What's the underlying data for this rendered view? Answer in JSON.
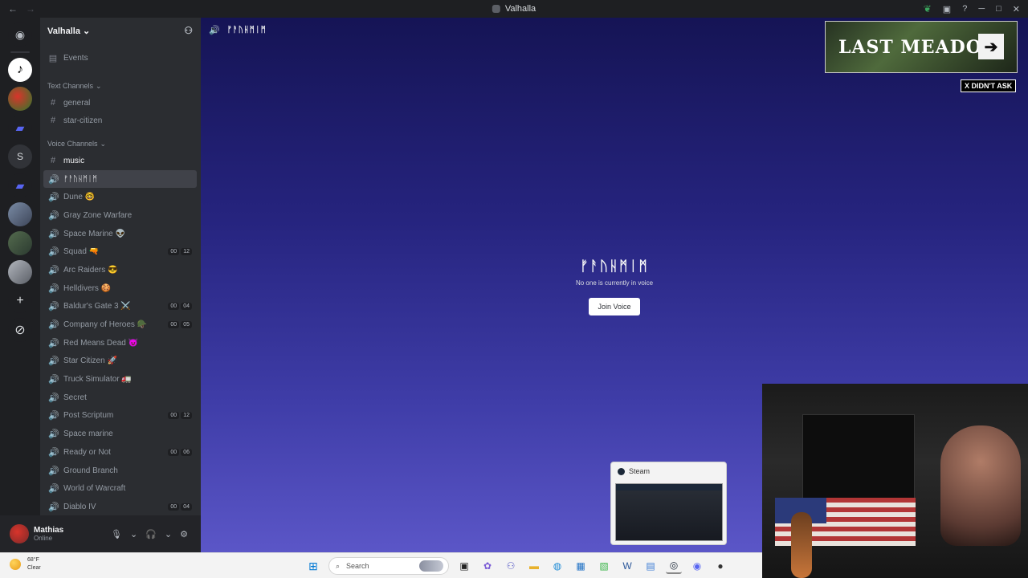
{
  "window": {
    "title": "Valhalla",
    "nav_back": "←",
    "nav_fwd": "→"
  },
  "titlebar_icons": {
    "leaf": "leaf-icon",
    "inbox": "inbox-icon",
    "help": "?",
    "minimize": "─",
    "maximize": "□",
    "close": "✕"
  },
  "rail": {
    "home_icon": "discord-icon",
    "s_label": "S",
    "add_icon": "+",
    "explore_icon": "compass-icon"
  },
  "guild": {
    "name": "Valhalla",
    "chevron": "⌄"
  },
  "sidebar": {
    "events_label": "Events",
    "text_category": "Text Channels",
    "voice_category": "Voice Channels",
    "text_channels": [
      {
        "name": "general"
      },
      {
        "name": "star-citizen"
      }
    ],
    "voice_channels": [
      {
        "name": "music",
        "type": "text"
      },
      {
        "name": "ᚠᚨᚢᚺᛗᛁᛗ",
        "type": "voice"
      },
      {
        "name": "Dune 🤓",
        "type": "voice"
      },
      {
        "name": "Gray Zone Warfare",
        "type": "voice"
      },
      {
        "name": "Space Marine 👽",
        "type": "voice"
      },
      {
        "name": "Squad 🔫",
        "type": "voice",
        "counts": [
          "00",
          "12"
        ]
      },
      {
        "name": "Arc Raiders 😎",
        "type": "voice"
      },
      {
        "name": "Helldivers 🍪",
        "type": "voice"
      },
      {
        "name": "Baldur's Gate 3 ⚔️",
        "type": "voice",
        "counts": [
          "00",
          "04"
        ]
      },
      {
        "name": "Company of Heroes 🪖",
        "type": "voice",
        "counts": [
          "00",
          "05"
        ]
      },
      {
        "name": "Red Means Dead 😈",
        "type": "voice"
      },
      {
        "name": "Star Citizen 🚀",
        "type": "voice"
      },
      {
        "name": "Truck Simulator 🚛",
        "type": "voice"
      },
      {
        "name": "Secret",
        "type": "voice"
      },
      {
        "name": "Post Scriptum",
        "type": "voice",
        "counts": [
          "00",
          "12"
        ]
      },
      {
        "name": "Space marine",
        "type": "voice"
      },
      {
        "name": "Ready or Not",
        "type": "voice",
        "counts": [
          "00",
          "06"
        ]
      },
      {
        "name": "Ground Branch",
        "type": "voice"
      },
      {
        "name": "World of Warcraft",
        "type": "voice"
      },
      {
        "name": "Diablo IV",
        "type": "voice",
        "counts": [
          "00",
          "04"
        ]
      }
    ]
  },
  "user": {
    "name": "Mathias",
    "status": "Online"
  },
  "main": {
    "header_channel": "ᚠᚨᚢᚺᛗᛁᛗ",
    "voice_title": "ᚠᚨᚢᚺᛗᛁᛗ",
    "voice_subtitle": "No one is currently in voice",
    "join_label": "Join Voice"
  },
  "overlay": {
    "banner_text": "LAST MEADOW",
    "banner_arrow": "➔",
    "badge": "X DIDN'T ASK"
  },
  "steam_preview": {
    "title": "Steam"
  },
  "taskbar": {
    "weather_temp": "68°F",
    "weather_cond": "Clear",
    "search_placeholder": "Search"
  }
}
